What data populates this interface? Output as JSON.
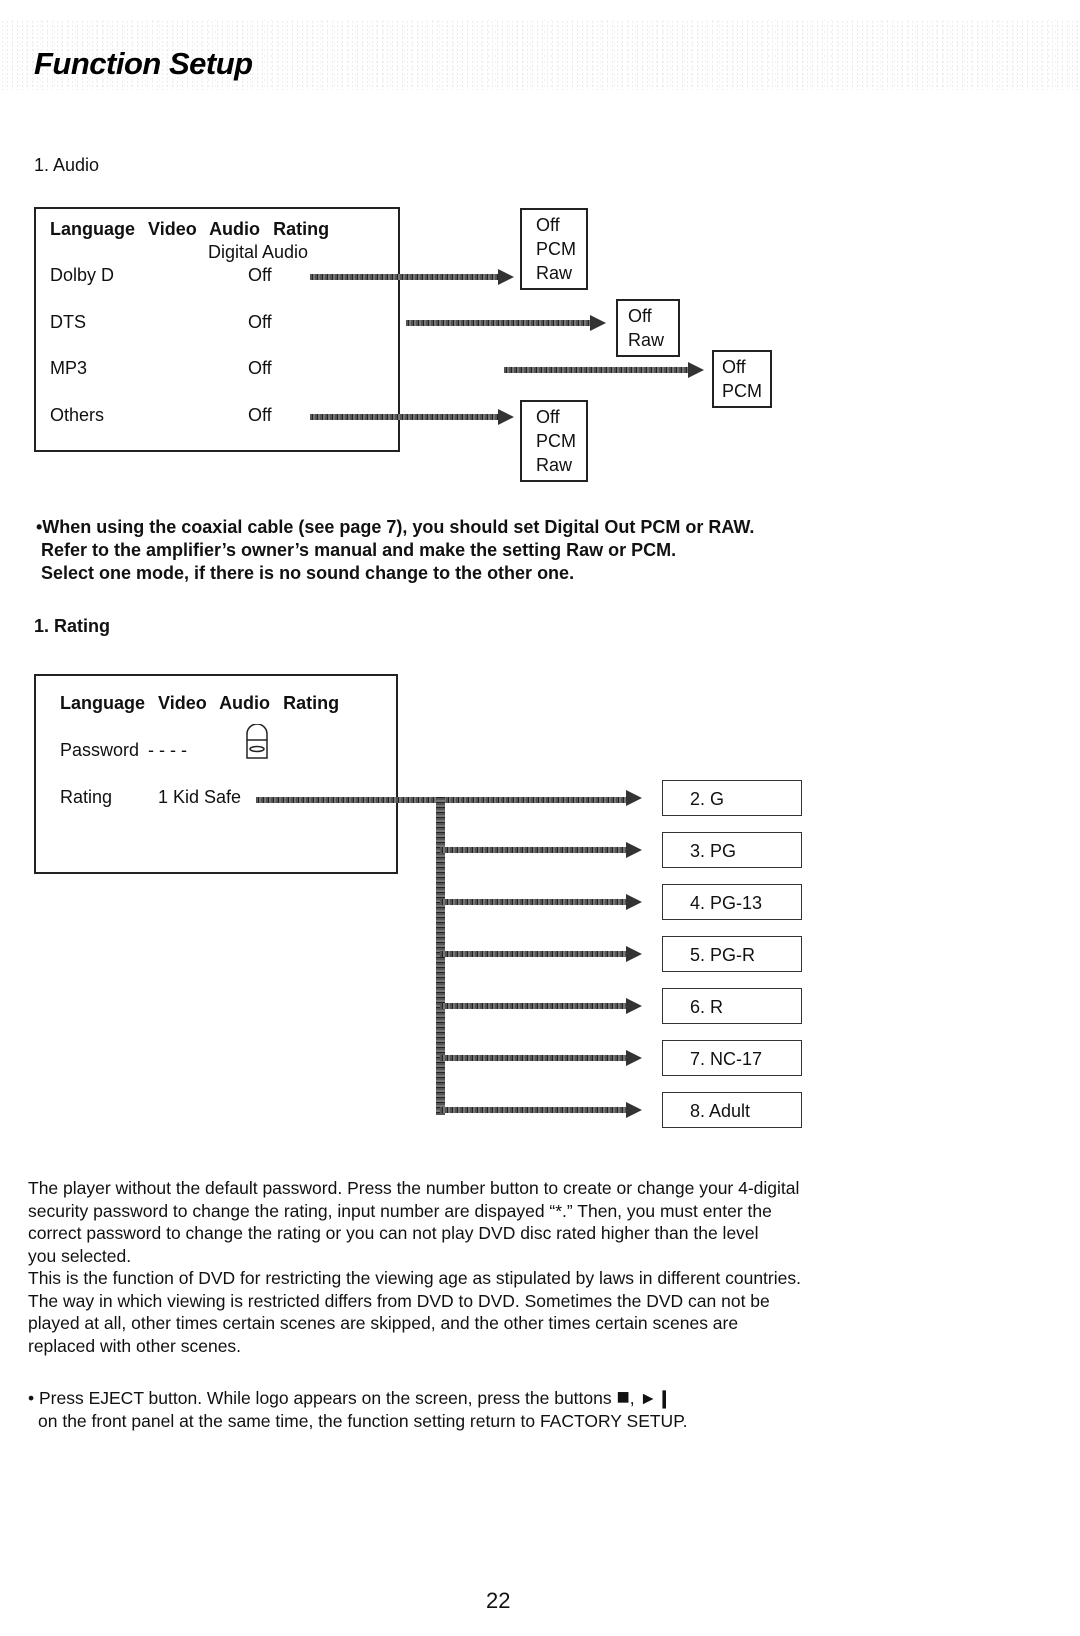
{
  "page": {
    "title": "Function Setup",
    "page_number": "22"
  },
  "audio": {
    "section_title": "1. Audio",
    "menu_tabs": [
      "Language",
      "Video",
      "Audio",
      "Rating"
    ],
    "column_header": "Digital Audio",
    "rows": [
      {
        "label": "Dolby D",
        "value": "Off",
        "options": [
          "Off",
          "PCM",
          "Raw"
        ]
      },
      {
        "label": "DTS",
        "value": "Off",
        "options": [
          "Off",
          "Raw"
        ]
      },
      {
        "label": "MP3",
        "value": "Off",
        "options": [
          "Off",
          "PCM"
        ]
      },
      {
        "label": "Others",
        "value": "Off",
        "options": [
          "Off",
          "PCM",
          "Raw"
        ]
      }
    ],
    "notes": [
      "•When using the coaxial cable (see page 7), you should set Digital Out PCM or RAW.",
      " Refer to the amplifier’s owner’s manual and make the setting Raw or PCM.",
      " Select one mode, if there is no sound change to the other one."
    ]
  },
  "rating": {
    "section_title": "1. Rating",
    "menu_tabs": [
      "Language",
      "Video",
      "Audio",
      "Rating"
    ],
    "password_label": "Password",
    "password_value": "- - - -",
    "lock_icon": "padlock-icon",
    "rating_label": "Rating",
    "rating_value": "1 Kid Safe",
    "options": [
      "2. G",
      "3. PG",
      "4. PG-13",
      "5. PG-R",
      "6. R",
      "7. NC-17",
      "8. Adult"
    ]
  },
  "body_text": {
    "paragraph1": [
      "The player without the default password. Press the number button to create or change your 4-digital",
      "security password to change the rating, input number are dispayed “*.” Then, you must enter the",
      "correct password to change the rating or you can not play DVD disc rated higher than the level",
      "you selected."
    ],
    "paragraph2": [
      "This is the function of DVD for restricting the viewing age as stipulated by laws in different countries.",
      "The way in which viewing is restricted differs from DVD to DVD. Sometimes the DVD can not be",
      "played at all, other times certain scenes are skipped, and the other times certain scenes are",
      "replaced with other scenes."
    ],
    "factory_reset": {
      "line1": "• Press EJECT button. While logo appears on the screen, press the buttons",
      "stop_glyph": "■",
      "separator": ",",
      "play_pause_glyph": "►❙",
      "line2": "on the front panel at the same time, the function setting return to FACTORY SETUP."
    }
  }
}
